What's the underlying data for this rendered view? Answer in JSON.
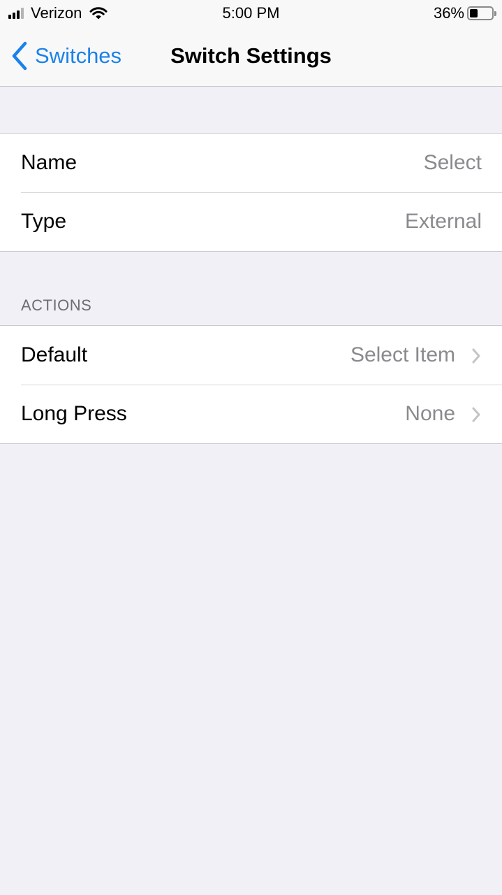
{
  "status_bar": {
    "carrier": "Verizon",
    "time": "5:00 PM",
    "battery_percent": "36%",
    "battery_level": 0.36,
    "signal_bars_filled": 3,
    "signal_bars_total": 4,
    "icons": [
      "signal-icon",
      "wifi-icon",
      "battery-icon"
    ]
  },
  "nav": {
    "back_label": "Switches",
    "title": "Switch Settings",
    "accent_color": "#1a82ea"
  },
  "general": {
    "rows": [
      {
        "label": "Name",
        "value": "Select"
      },
      {
        "label": "Type",
        "value": "External"
      }
    ]
  },
  "actions": {
    "header": "ACTIONS",
    "rows": [
      {
        "label": "Default",
        "value": "Select Item",
        "icon": "chevron-right-icon"
      },
      {
        "label": "Long Press",
        "value": "None",
        "icon": "chevron-right-icon"
      }
    ]
  },
  "colors": {
    "background": "#f0f0f6",
    "cell": "#ffffff",
    "secondary_text": "#8a8a8e"
  }
}
